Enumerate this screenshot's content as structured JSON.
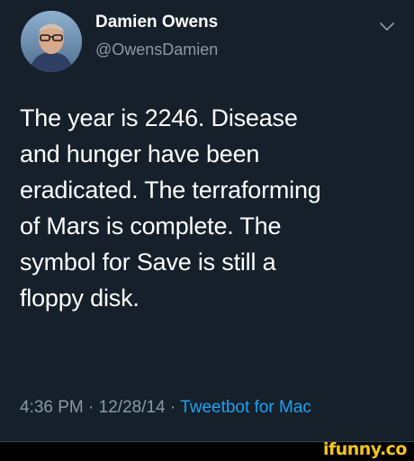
{
  "author": {
    "display_name": "Damien Owens",
    "handle": "@OwensDamien",
    "avatar_icon": "profile-photo",
    "menu_icon": "chevron-down-icon"
  },
  "tweet": {
    "lines": [
      "The year is 2246. Disease",
      "and hunger have been",
      "eradicated. The terraforming",
      "of Mars is complete. The",
      "symbol for Save is still a",
      "floppy disk."
    ],
    "time": "4:36 PM",
    "separator": "·",
    "date": "12/28/14",
    "source": "Tweetbot for Mac"
  },
  "watermark": {
    "text": "ifunny.co"
  },
  "colors": {
    "background": "#15202b",
    "text": "#ffffff",
    "secondary_text": "#8899a6",
    "link": "#1da1f2",
    "watermark": "#f5c518"
  }
}
